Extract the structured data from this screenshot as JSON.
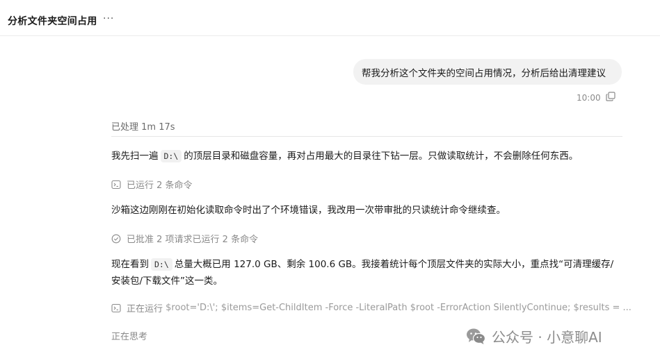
{
  "header": {
    "title": "分析文件夹空间占用",
    "more_label": "···"
  },
  "user_message": {
    "text": "帮我分析这个文件夹的空间占用情况，分析后给出清理建议",
    "time": "10:00"
  },
  "assistant": {
    "processed": "已处理 1m 17s",
    "para1_before": "我先扫一遍",
    "para1_code": "D:\\",
    "para1_after": "的顶层目录和磁盘容量，再对占用最大的目录往下钻一层。只做读取统计，不会删除任何东西。",
    "status1": "已运行 2 条命令",
    "para2": "沙箱这边刚刚在初始化读取命令时出了个环境错误，我改用一次带审批的只读统计命令继续查。",
    "status2": "已批准 2 项请求已运行 2 条命令",
    "para3_before": "现在看到",
    "para3_code": "D:\\",
    "para3_after": "总量大概已用 127.0 GB、剩余 100.6 GB。我接着统计每个顶层文件夹的实际大小，重点找“可清理缓存/安装包/下载文件”这一类。",
    "status3_label": "正在运行",
    "status3_command": "$root='D:\\'; $items=Get-ChildItem -Force -LiteralPath $root -ErrorAction SilentlyContinue; $results = ...",
    "thinking": "正在思考"
  },
  "watermark": {
    "text": "公众号 · 小意聊AI"
  },
  "icons": {
    "more": "more-horizontal-icon",
    "copy": "copy-icon",
    "terminal": "terminal-icon",
    "check": "check-circle-icon",
    "wechat": "wechat-icon"
  }
}
